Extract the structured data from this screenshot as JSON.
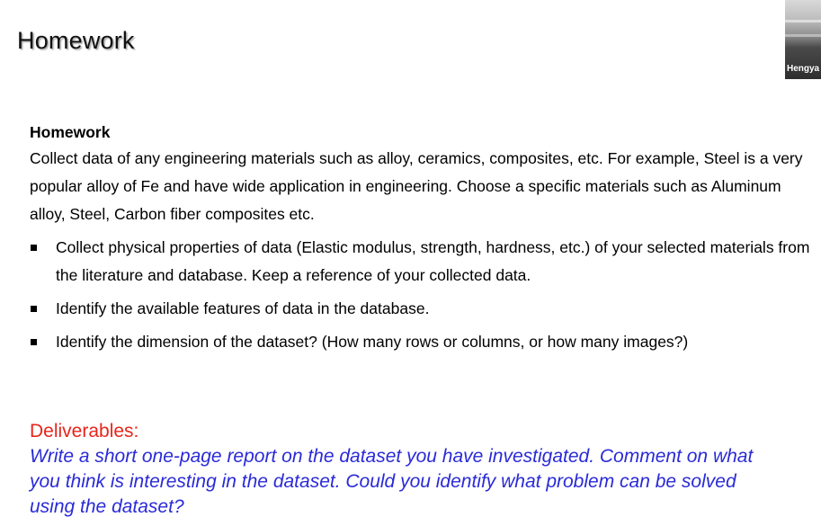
{
  "slide": {
    "title": "Homework"
  },
  "webcam": {
    "name": "Hengya"
  },
  "content": {
    "subheading": "Homework",
    "intro": "Collect data of any engineering materials such as alloy, ceramics, composites, etc. For example, Steel is a very popular alloy of Fe and have wide application in engineering. Choose a specific materials such as Aluminum alloy, Steel, Carbon fiber composites etc.",
    "bullets": [
      "Collect physical properties of data (Elastic modulus, strength, hardness, etc.) of your selected materials from the literature and database. Keep a reference of your collected data.",
      "Identify the available features of data in the database.",
      "Identify the dimension of the dataset? (How many rows or columns, or how many images?)"
    ]
  },
  "deliverables": {
    "label": "Deliverables:",
    "body": "Write a short one-page report on the dataset you have investigated. Comment on what you think is interesting in the dataset.  Could you identify what problem can be solved using the dataset?"
  },
  "colors": {
    "deliverables_label": "#e8251a",
    "deliverables_body": "#2a2ad8"
  },
  "icons": {
    "bullet": "square-bullet-icon"
  }
}
